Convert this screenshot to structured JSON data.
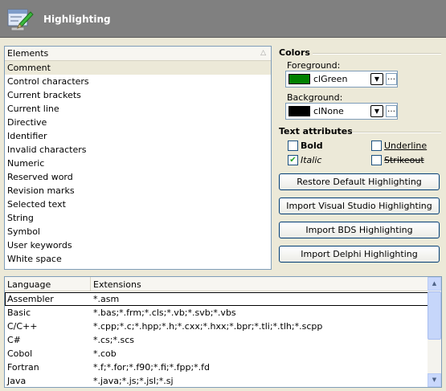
{
  "header": {
    "title": "Highlighting",
    "logo_icon": "highlighting-logo-icon"
  },
  "elements": {
    "column_header": "Elements",
    "items": [
      "Comment",
      "Control characters",
      "Current brackets",
      "Current line",
      "Directive",
      "Identifier",
      "Invalid characters",
      "Numeric",
      "Reserved word",
      "Revision marks",
      "Selected text",
      "String",
      "Symbol",
      "User keywords",
      "White space"
    ],
    "selected": "Comment"
  },
  "colors": {
    "group_label": "Colors",
    "foreground_label": "Foreground:",
    "foreground": {
      "name": "clGreen",
      "swatch": "#008000"
    },
    "background_label": "Background:",
    "background": {
      "name": "clNone",
      "swatch": "#000000"
    }
  },
  "text_attributes": {
    "group_label": "Text attributes",
    "bold": {
      "label": "Bold",
      "checked": false
    },
    "italic": {
      "label": "Italic",
      "checked": true
    },
    "underline": {
      "label": "Underline",
      "checked": false
    },
    "strikeout": {
      "label": "Strikeout",
      "checked": false
    }
  },
  "buttons": {
    "restore": "Restore Default Highlighting",
    "import_vs": "Import Visual Studio Highlighting",
    "import_bds": "Import BDS Highlighting",
    "import_delphi": "Import Delphi Highlighting"
  },
  "languages": {
    "col_language": "Language",
    "col_extensions": "Extensions",
    "rows": [
      {
        "language": "Assembler",
        "extensions": "*.asm"
      },
      {
        "language": "Basic",
        "extensions": "*.bas;*.frm;*.cls;*.vb;*.svb;*.vbs"
      },
      {
        "language": "C/C++",
        "extensions": "*.cpp;*.c;*.hpp;*.h;*.cxx;*.hxx;*.bpr;*.tli;*.tlh;*.scpp"
      },
      {
        "language": "C#",
        "extensions": "*.cs;*.scs"
      },
      {
        "language": "Cobol",
        "extensions": "*.cob"
      },
      {
        "language": "Fortran",
        "extensions": "*.f;*.for;*.f90;*.fi;*.fpp;*.fd"
      },
      {
        "language": "Java",
        "extensions": "*.java;*.js;*.jsl;*.sj"
      }
    ],
    "selected": "Assembler"
  }
}
